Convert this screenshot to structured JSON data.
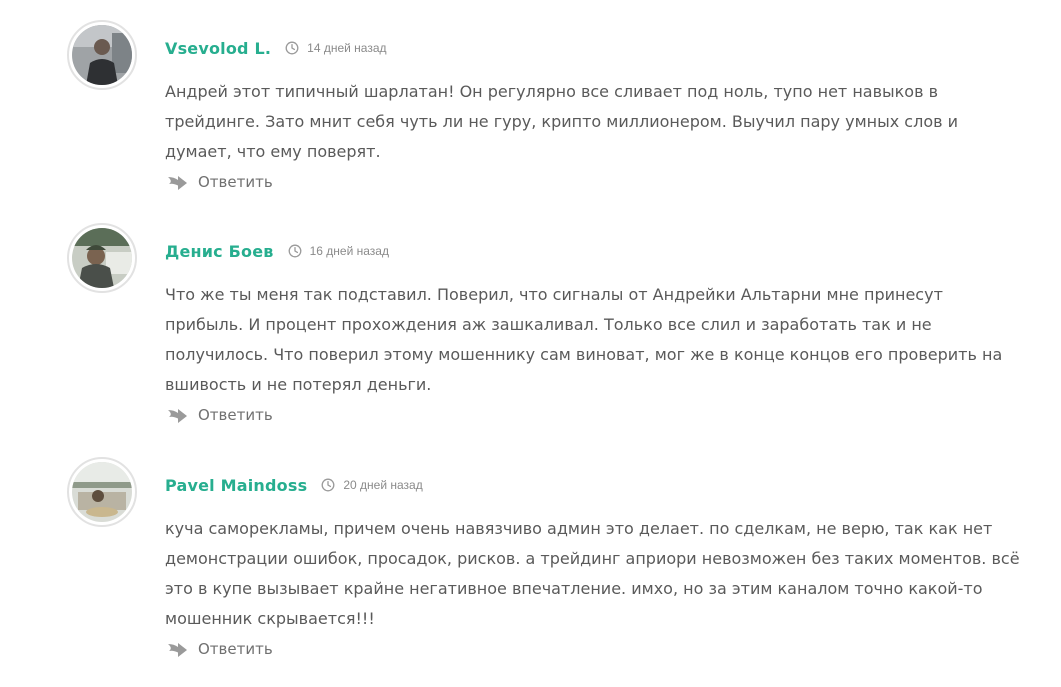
{
  "comments": [
    {
      "author": "Vsevolod L.",
      "date": "14 дней назад",
      "text": "Андрей этот типичный шарлатан! Он регулярно все сливает под ноль, тупо нет навыков в трейдинге. Зато мнит себя чуть ли не гуру, крипто миллионером. Выучил пару умных слов и думает, что ему поверят.",
      "reply_label": "Ответить",
      "avatar_icon": "user-avatar-photo"
    },
    {
      "author": "Денис Боев",
      "date": "16 дней назад",
      "text": "Что же ты меня так подставил. Поверил, что сигналы от Андрейки Альтарни мне принесут прибыль. И процент прохождения аж зашкаливал. Только все слил и заработать так и не получилось. Что поверил этому мошеннику сам виноват, мог же в конце концов его проверить на вшивость и не потерял деньги.",
      "reply_label": "Ответить",
      "avatar_icon": "user-avatar-photo"
    },
    {
      "author": "Pavel Maindoss",
      "date": "20 дней назад",
      "text": "куча саморекламы, причем очень навязчиво админ это делает. по сделкам, не верю, так как нет демонстрации ошибок, просадок, рисков. а трейдинг априори невозможен без таких моментов. всё это в купе вызывает крайне негативное впечатление. имхо, но за этим каналом точно какой-то мошенник скрывается!!!",
      "reply_label": "Ответить",
      "avatar_icon": "user-avatar-photo"
    }
  ],
  "colors": {
    "author": "#27ae8f",
    "text": "#5a5a5a",
    "meta": "#8a8a8a",
    "icon": "#9a9a9a"
  },
  "icons": {
    "date": "clock-icon",
    "reply": "reply-arrow-icon"
  }
}
